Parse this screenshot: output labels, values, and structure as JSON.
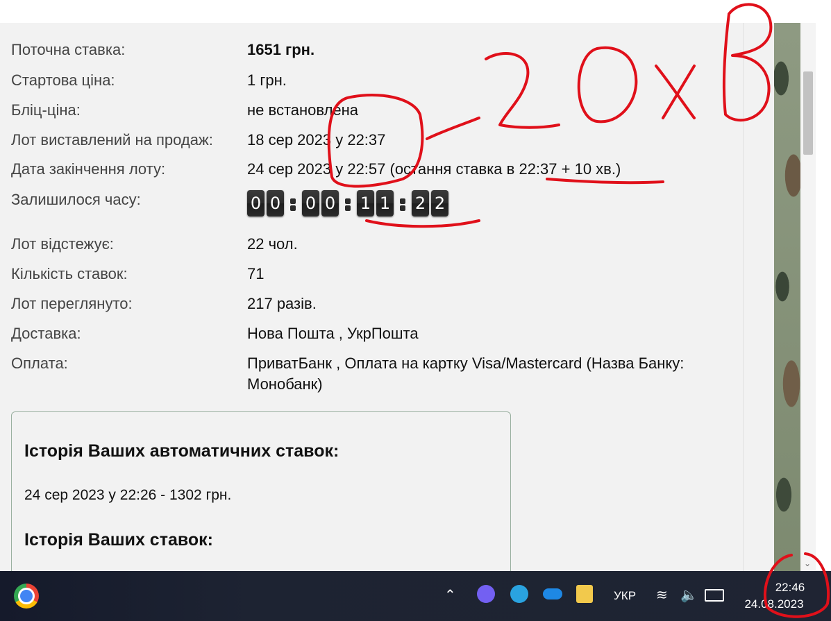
{
  "lot_info": {
    "current_bid_label": "Поточна ставка:",
    "current_bid_value": "1651 грн.",
    "start_price_label": "Стартова ціна:",
    "start_price_value": "1 грн.",
    "blitz_price_label": "Бліц-ціна:",
    "blitz_price_value": "не встановлена",
    "listed_label": "Лот виставлений на продаж:",
    "listed_value": "18 сер 2023 у 22:37",
    "end_date_label": "Дата закінчення лоту:",
    "end_date_value": "24 сер 2023 у 22:57 (остання ставка в 22:37 + 10 хв.)",
    "time_left_label": "Залишилося часу:",
    "watchers_label": "Лот відстежує:",
    "watchers_value": "22 чол.",
    "bids_count_label": "Кількість ставок:",
    "bids_count_value": "71",
    "views_label": "Лот переглянуто:",
    "views_value": "217 разів.",
    "delivery_label": "Доставка:",
    "delivery_value": "Нова Пошта , УкрПошта",
    "payment_label": "Оплата:",
    "payment_value": "ПриватБанк , Оплата на картку Visa/Mastercard (Назва Банку: Монобанк)"
  },
  "countdown": {
    "digits": [
      "0",
      "0",
      "0",
      "0",
      "1",
      "1",
      "2",
      "2"
    ]
  },
  "history": {
    "auto_title": "Історія Ваших автоматичних ставок:",
    "auto_entry": "24 сер 2023 у 22:26 - 1302 грн.",
    "bids_title": "Історія Ваших ставок:"
  },
  "taskbar": {
    "language": "УКР",
    "time": "22:46",
    "date": "24.08.2023"
  },
  "annotation": {
    "handwritten_text": "20хв",
    "color": "#e0101a"
  },
  "icons": [
    "chrome-icon",
    "chevron-up-icon",
    "viber-icon",
    "telegram-icon",
    "onedrive-icon",
    "lock-icon",
    "wifi-icon",
    "volume-icon",
    "battery-icon"
  ]
}
